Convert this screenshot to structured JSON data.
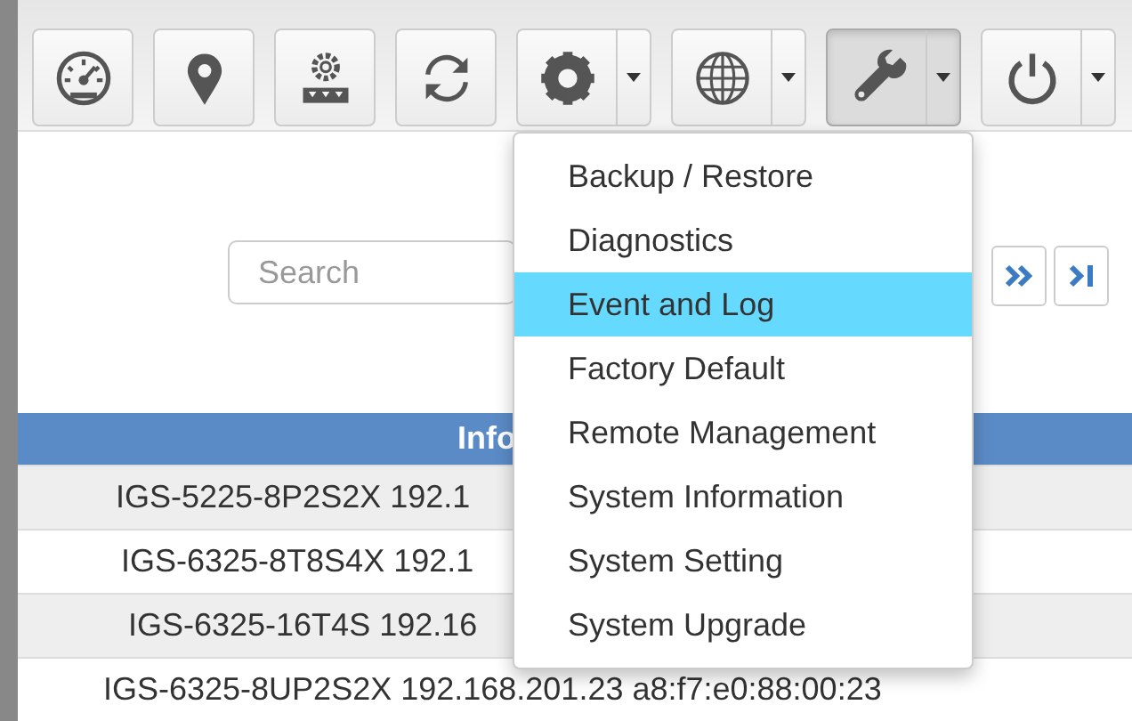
{
  "toolbar": [
    {
      "dropdown": false,
      "active": false
    },
    {
      "dropdown": false,
      "active": false
    },
    {
      "dropdown": false,
      "active": false
    },
    {
      "dropdown": false,
      "active": false
    },
    {
      "dropdown": true,
      "active": false
    },
    {
      "dropdown": true,
      "active": false
    },
    {
      "dropdown": true,
      "active": true
    },
    {
      "dropdown": true,
      "active": false
    }
  ],
  "menu": [
    {
      "label": "Backup / Restore",
      "selected": false
    },
    {
      "label": "Diagnostics",
      "selected": false
    },
    {
      "label": "Event and Log",
      "selected": true
    },
    {
      "label": "Factory Default",
      "selected": false
    },
    {
      "label": "Remote Management",
      "selected": false
    },
    {
      "label": "System Information",
      "selected": false
    },
    {
      "label": "System Setting",
      "selected": false
    },
    {
      "label": "System Upgrade",
      "selected": false
    }
  ],
  "search": {
    "placeholder": "Search"
  },
  "table": {
    "header": "Info",
    "rows": [
      "IGS-5225-8P2S2X 192.1",
      "IGS-6325-8T8S4X 192.1",
      "IGS-6325-16T4S 192.16",
      "IGS-6325-8UP2S2X 192.168.201.23 a8:f7:e0:88:00:23"
    ]
  }
}
